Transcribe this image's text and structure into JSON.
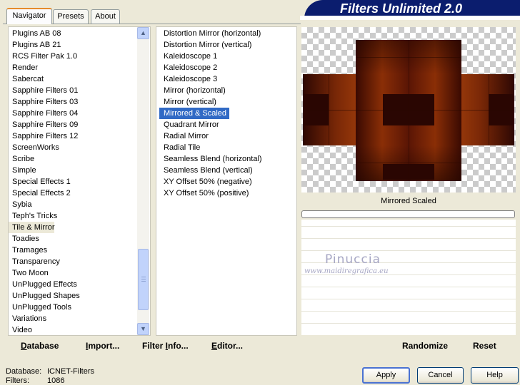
{
  "banner": {
    "title": "Filters Unlimited 2.0"
  },
  "tabs": [
    {
      "label": "Navigator",
      "active": true
    },
    {
      "label": "Presets",
      "active": false
    },
    {
      "label": "About",
      "active": false
    }
  ],
  "categories": [
    "Plugins AB 08",
    "Plugins AB 21",
    "RCS Filter Pak 1.0",
    "Render",
    "Sabercat",
    "Sapphire Filters 01",
    "Sapphire Filters 03",
    "Sapphire Filters 04",
    "Sapphire Filters 09",
    "Sapphire Filters 12",
    "ScreenWorks",
    "Scribe",
    "Simple",
    "Special Effects 1",
    "Special Effects 2",
    "Sybia",
    "Teph's Tricks",
    "Tile & Mirror",
    "Toadies",
    "Tramages",
    "Transparency",
    "Two Moon",
    "UnPlugged Effects",
    "UnPlugged Shapes",
    "UnPlugged Tools",
    "Variations",
    "Video"
  ],
  "selected_category": "Tile & Mirror",
  "filters": [
    "Distortion Mirror (horizontal)",
    "Distortion Mirror (vertical)",
    "Kaleidoscope 1",
    "Kaleidoscope 2",
    "Kaleidoscope 3",
    "Mirror (horizontal)",
    "Mirror (vertical)",
    "Mirrored & Scaled",
    "Quadrant Mirror",
    "Radial Mirror",
    "Radial Tile",
    "Seamless Blend (horizontal)",
    "Seamless Blend (vertical)",
    "XY Offset 50% (negative)",
    "XY Offset 50% (positive)"
  ],
  "selected_filter": "Mirrored & Scaled",
  "preview": {
    "filter_label": "Mirrored  Scaled"
  },
  "watermark": {
    "name": "Pinuccia",
    "url": "www.maidiregrafica.eu"
  },
  "toolbar": {
    "database": {
      "hot": "D",
      "rest": "atabase"
    },
    "import": {
      "hot": "I",
      "rest": "mport..."
    },
    "filter_info": {
      "pre": "Filter ",
      "hot": "I",
      "rest": "nfo..."
    },
    "editor": {
      "hot": "E",
      "rest": "ditor..."
    },
    "randomize": "Randomize",
    "reset": "Reset"
  },
  "status": {
    "database_label": "Database:",
    "database_value": "ICNET-Filters",
    "filters_label": "Filters:",
    "filters_value": "1086"
  },
  "buttons": {
    "apply": "Apply",
    "cancel": "Cancel",
    "help": "Help"
  },
  "colors": {
    "selection": "#316ac5",
    "tab_highlight": "#e68b2c",
    "banner": "#0b1d6e"
  }
}
